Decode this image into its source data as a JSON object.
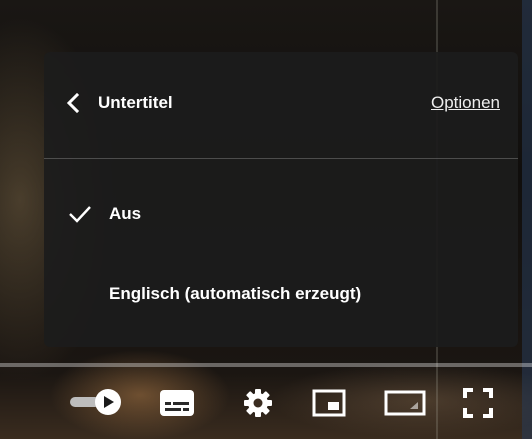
{
  "menu": {
    "title": "Untertitel",
    "options_label": "Optionen",
    "items": [
      {
        "label": "Aus",
        "selected": true
      },
      {
        "label": "Englisch (automatisch erzeugt)",
        "selected": false
      }
    ]
  },
  "controls": {
    "icons": [
      "autoplay-toggle-icon",
      "subtitles-icon",
      "settings-gear-icon",
      "miniplayer-icon",
      "theater-mode-icon",
      "fullscreen-icon"
    ]
  }
}
